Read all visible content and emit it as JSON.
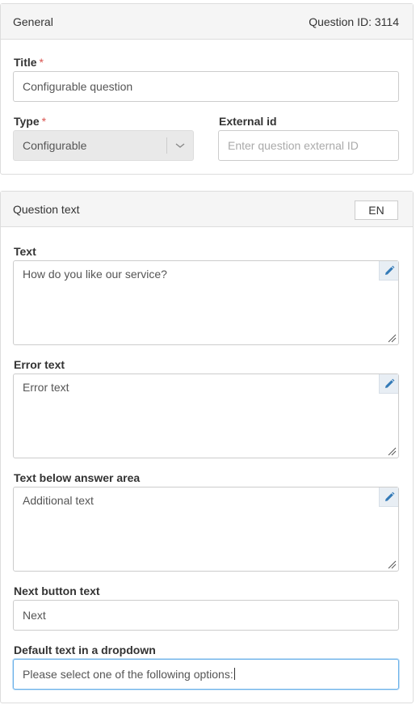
{
  "general": {
    "header_title": "General",
    "question_id_label": "Question ID: 3114",
    "title_label": "Title",
    "required_mark": "*",
    "title_value": "Configurable question",
    "type_label": "Type",
    "type_value": "Configurable",
    "external_id_label": "External id",
    "external_id_placeholder": "Enter question external ID"
  },
  "question_text": {
    "header_title": "Question text",
    "language": "EN",
    "text_label": "Text",
    "text_value": "How do you like our service?",
    "error_label": "Error text",
    "error_value": "Error text",
    "below_label": "Text below answer area",
    "below_value": "Additional text",
    "next_label": "Next button text",
    "next_value": "Next",
    "dropdown_label": "Default text in a dropdown",
    "dropdown_value": "Please select one of the following options:"
  },
  "icons": {
    "edit": "pencil-icon",
    "select": "chevron-down-icon",
    "resize": "resize-handle-icon"
  },
  "colors": {
    "required": "#d9534f",
    "edit_icon": "#337ab7",
    "focus_border": "#66afe9"
  }
}
